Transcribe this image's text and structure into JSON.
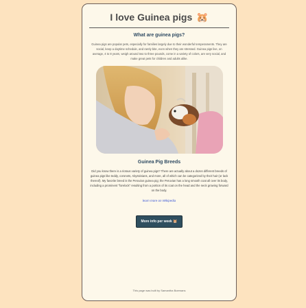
{
  "header": {
    "title": "I love Guinea pigs",
    "title_icon": "🐹"
  },
  "intro": {
    "heading": "What are guinea pigs?",
    "text": "Guinea pigs are popular pets, especially for families largely due to their wonderful temperaments. They are social, keep a daytime schedule, and rarely bite, even when they are stressed. Guinea pigs live, on average, 4 to 8 years, weigh around two to three pounds, come in a variety of colors, are very social, and make great pets for children and adults alike."
  },
  "breeds": {
    "heading": "Guinea Pig Breeds",
    "text": "Did you know there is a riotous variety of guinea pigs? There are actually about a dozen different breeds of guinea pigs like teddy, coronets, Abyssinians, and more, all of which can be categorized by their hair (or lack thereof). My favorite breed is the Peruvian guinea pig; the Peruvian has a long smooth coat all over its body, including a prominent \"forelock\" resulting from a portion of its coat on the head and the neck growing forward on the body."
  },
  "link": {
    "label": "learn more on Wikipedia"
  },
  "fact_button": {
    "label": "More info per week 🐹"
  },
  "footer": {
    "text": "This page was built by Samantha Boemans"
  },
  "colors": {
    "page_background": "#fde3bf",
    "card_background": "#fdf8ea",
    "heading": "#2e4a62",
    "button": "#2f4f5f",
    "link": "#3b58d6"
  }
}
